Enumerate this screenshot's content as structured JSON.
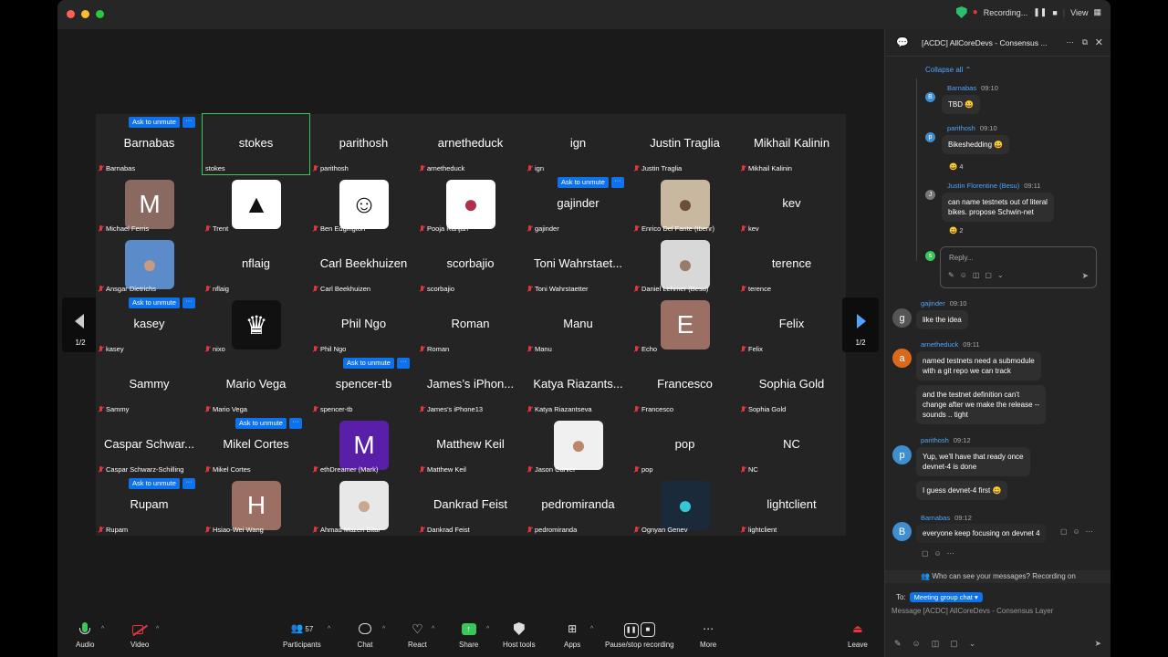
{
  "titlebar": {
    "recording_label": "Recording...",
    "view_label": "View"
  },
  "ask_label": "Ask to unmute",
  "more_label": "···",
  "tiles": [
    {
      "big": "Barnabas",
      "small": "Barnabas",
      "ask": true
    },
    {
      "big": "stokes",
      "small": "stokes",
      "active": true,
      "nomic": true
    },
    {
      "big": "parithosh",
      "small": "parithosh"
    },
    {
      "big": "arnetheduck",
      "small": "arnetheduck"
    },
    {
      "big": "ign",
      "small": "ign"
    },
    {
      "big": "Justin Traglia",
      "small": "Justin Traglia"
    },
    {
      "big": "Mikhail Kalinin",
      "small": "Mikhail Kalinin"
    },
    {
      "small": "Michael Ferris",
      "avatar": "M",
      "avcolor": "#8a6a60"
    },
    {
      "small": "Trent",
      "avatar": "▲",
      "avcolor": "#ffffff",
      "avtext": "#111"
    },
    {
      "small": "Ben Edgington",
      "avatar": "☺",
      "avcolor": "#ffffff",
      "avtext": "#111"
    },
    {
      "small": "Pooja Ranjan",
      "avatar": "●",
      "avcolor": "#ffffff",
      "avtext": "#b0304a"
    },
    {
      "big": "gajinder",
      "small": "gajinder",
      "ask": true
    },
    {
      "small": "Enrico Del Fante (tbenr)",
      "avatar": "●",
      "avcolor": "#c9b8a0",
      "avtext": "#6b4f3a"
    },
    {
      "big": "kev",
      "small": "kev"
    },
    {
      "small": "Ansgar Dietrichs",
      "avatar": "●",
      "avcolor": "#5b8bc9",
      "avtext": "#c89a80"
    },
    {
      "big": "nflaig",
      "small": "nflaig"
    },
    {
      "big": "Carl Beekhuizen",
      "small": "Carl Beekhuizen"
    },
    {
      "big": "scorbajio",
      "small": "scorbajio"
    },
    {
      "big": "Toni Wahrstaet...",
      "small": "Toni Wahrstaetter"
    },
    {
      "small": "Daniel Lehrner (Besu)",
      "avatar": "●",
      "avcolor": "#d8d8d8",
      "avtext": "#9a7a6a"
    },
    {
      "big": "terence",
      "small": "terence"
    },
    {
      "big": "kasey",
      "small": "kasey",
      "ask": true
    },
    {
      "small": "nixo",
      "avatar": "♛",
      "avcolor": "#111111",
      "avtext": "#ffffff"
    },
    {
      "big": "Phil Ngo",
      "small": "Phil Ngo"
    },
    {
      "big": "Roman",
      "small": "Roman"
    },
    {
      "big": "Manu",
      "small": "Manu"
    },
    {
      "small": "Echo",
      "avatar": "E",
      "avcolor": "#9b6f64"
    },
    {
      "big": "Felix",
      "small": "Felix"
    },
    {
      "big": "Sammy",
      "small": "Sammy"
    },
    {
      "big": "Mario Vega",
      "small": "Mario Vega"
    },
    {
      "big": "spencer-tb",
      "small": "spencer-tb",
      "ask": true
    },
    {
      "big": "James’s iPhon...",
      "small": "James's iPhone13"
    },
    {
      "big": "Katya Riazants...",
      "small": "Katya Riazantseva"
    },
    {
      "big": "Francesco",
      "small": "Francesco"
    },
    {
      "big": "Sophia Gold",
      "small": "Sophia Gold"
    },
    {
      "big": "Caspar Schwar...",
      "small": "Caspar Schwarz-Schilling"
    },
    {
      "big": "Mikel Cortes",
      "small": "Mikel Cortes",
      "ask": true
    },
    {
      "small": "ethDreamer (Mark)",
      "avatar": "M",
      "avcolor": "#5a1fa8"
    },
    {
      "big": "Matthew Keil",
      "small": "Matthew Keil"
    },
    {
      "small": "Jason Carver",
      "avatar": "●",
      "avcolor": "#f0f0f0",
      "avtext": "#b88868"
    },
    {
      "big": "pop",
      "small": "pop"
    },
    {
      "big": "NC",
      "small": "NC"
    },
    {
      "big": "Rupam",
      "small": "Rupam",
      "ask": true
    },
    {
      "small": "Hsiao-Wei Wang",
      "avatar": "H",
      "avcolor": "#9b6f64"
    },
    {
      "small": "Ahmad Mazen Bitar",
      "avatar": "●",
      "avcolor": "#e8e8e8",
      "avtext": "#c8a890"
    },
    {
      "big": "Dankrad Feist",
      "small": "Dankrad Feist"
    },
    {
      "big": "pedromiranda",
      "small": "pedromiranda"
    },
    {
      "small": "Ognyan Genev",
      "avatar": "●",
      "avcolor": "#1b2a3a",
      "avtext": "#36c6d8"
    },
    {
      "big": "lightclient",
      "small": "lightclient"
    }
  ],
  "pager": {
    "left": "1/2",
    "right": "1/2"
  },
  "toolbar": {
    "audio": "Audio",
    "video": "Video",
    "participants": "Participants",
    "participants_count": "57",
    "chat": "Chat",
    "react": "React",
    "share": "Share",
    "host_tools": "Host tools",
    "apps": "Apps",
    "recording": "Pause/stop recording",
    "more": "More",
    "leave": "Leave"
  },
  "chat": {
    "title": "[ACDC] AllCoreDevs - Consensus ...",
    "collapse": "Collapse all",
    "m1_name": "Barnabas",
    "m1_time": "09:10",
    "m1_text": "TBD 😀",
    "m2_name": "parithosh",
    "m2_time": "09:10",
    "m2_text": "Bikeshedding 😀",
    "m2_react": "😀 4",
    "m3_name": "Justin Florentine (Besu)",
    "m3_time": "09:11",
    "m3_text1": "can name testnets out of literal",
    "m3_text2": "bikes. propose Schwin-net",
    "m3_react": "😀 2",
    "reply_ph": "Reply...",
    "m4_name": "gajinder",
    "m4_time": "09:10",
    "m4_text": "like the idea",
    "m5_name": "arnetheduck",
    "m5_time": "09:11",
    "m5_text1": "named testnets need a submodule",
    "m5_text2": "with a git repo we can track",
    "m5b_text1": "and the testnet definition can't",
    "m5b_text2": "change after we make the release --",
    "m5b_text3": "sounds .. tight",
    "m6_name": "parithosh",
    "m6_time": "09:12",
    "m6_text1": "Yup, we'll have that ready once",
    "m6_text2": "devnet-4 is done",
    "m6b_text": "I guess devnet-4 first 😀",
    "m7_name": "Barnabas",
    "m7_time": "09:12",
    "m7_text": "everyone keep focusing on devnet 4",
    "who": "Who can see your messages? Recording on",
    "to": "To:",
    "to_target": "Meeting group chat ▾",
    "input_ph": "Message [ACDC] AllCoreDevs - Consensus Layer"
  }
}
